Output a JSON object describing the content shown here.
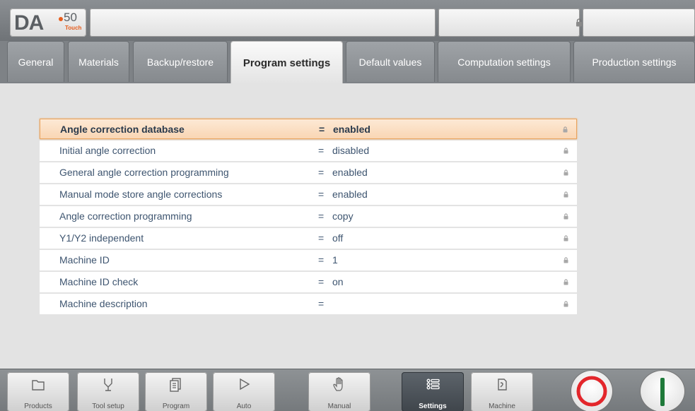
{
  "brand": {
    "logo_text": "DA",
    "model": "50",
    "edition": "Touch"
  },
  "tabs": [
    {
      "label": "General",
      "active": false
    },
    {
      "label": "Materials",
      "active": false
    },
    {
      "label": "Backup/restore",
      "active": false
    },
    {
      "label": "Program settings",
      "active": true
    },
    {
      "label": "Default values",
      "active": false
    },
    {
      "label": "Computation settings",
      "active": false
    },
    {
      "label": "Production settings",
      "active": false
    }
  ],
  "settings": [
    {
      "name": "Angle correction database",
      "eq": "=",
      "value": "enabled",
      "selected": true
    },
    {
      "name": "Initial angle correction",
      "eq": "=",
      "value": "disabled"
    },
    {
      "name": "General angle correction programming",
      "eq": "=",
      "value": "enabled"
    },
    {
      "name": "Manual mode store angle corrections",
      "eq": "=",
      "value": "enabled"
    },
    {
      "name": "Angle correction programming",
      "eq": "=",
      "value": "copy"
    },
    {
      "name": "Y1/Y2 independent",
      "eq": "=",
      "value": "off"
    },
    {
      "name": "Machine ID",
      "eq": "=",
      "value": "1"
    },
    {
      "name": "Machine ID check",
      "eq": "=",
      "value": "on"
    },
    {
      "name": "Machine description",
      "eq": "=",
      "value": ""
    }
  ],
  "nav": [
    {
      "label": "Products",
      "icon": "folder-icon",
      "active": false
    },
    {
      "label": "Tool setup",
      "icon": "tool-setup-icon",
      "active": false
    },
    {
      "label": "Program",
      "icon": "program-icon",
      "active": false
    },
    {
      "label": "Auto",
      "icon": "play-icon",
      "active": false
    },
    {
      "label": "Manual",
      "icon": "hand-icon",
      "active": false
    },
    {
      "label": "Settings",
      "icon": "settings-list-icon",
      "active": true
    },
    {
      "label": "Machine",
      "icon": "machine-icon",
      "active": false
    }
  ],
  "colors": {
    "accent": "#e85d1c",
    "selected_border": "#e9a45f",
    "stop": "#e3262b",
    "start": "#1f7a3a"
  }
}
